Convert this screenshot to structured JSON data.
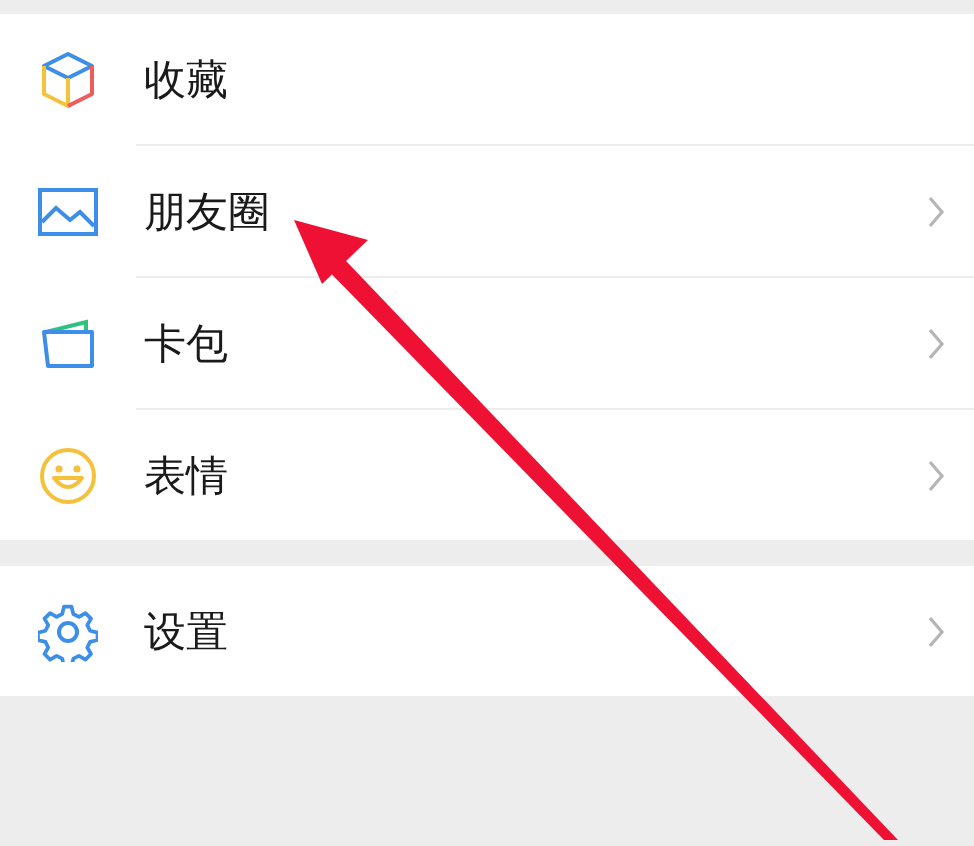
{
  "groups": [
    {
      "items": [
        {
          "label": "收藏",
          "chevron": false
        },
        {
          "label": "朋友圈",
          "chevron": true
        },
        {
          "label": "卡包",
          "chevron": true
        },
        {
          "label": "表情",
          "chevron": true
        }
      ]
    },
    {
      "items": [
        {
          "label": "设置",
          "chevron": true
        }
      ]
    }
  ]
}
